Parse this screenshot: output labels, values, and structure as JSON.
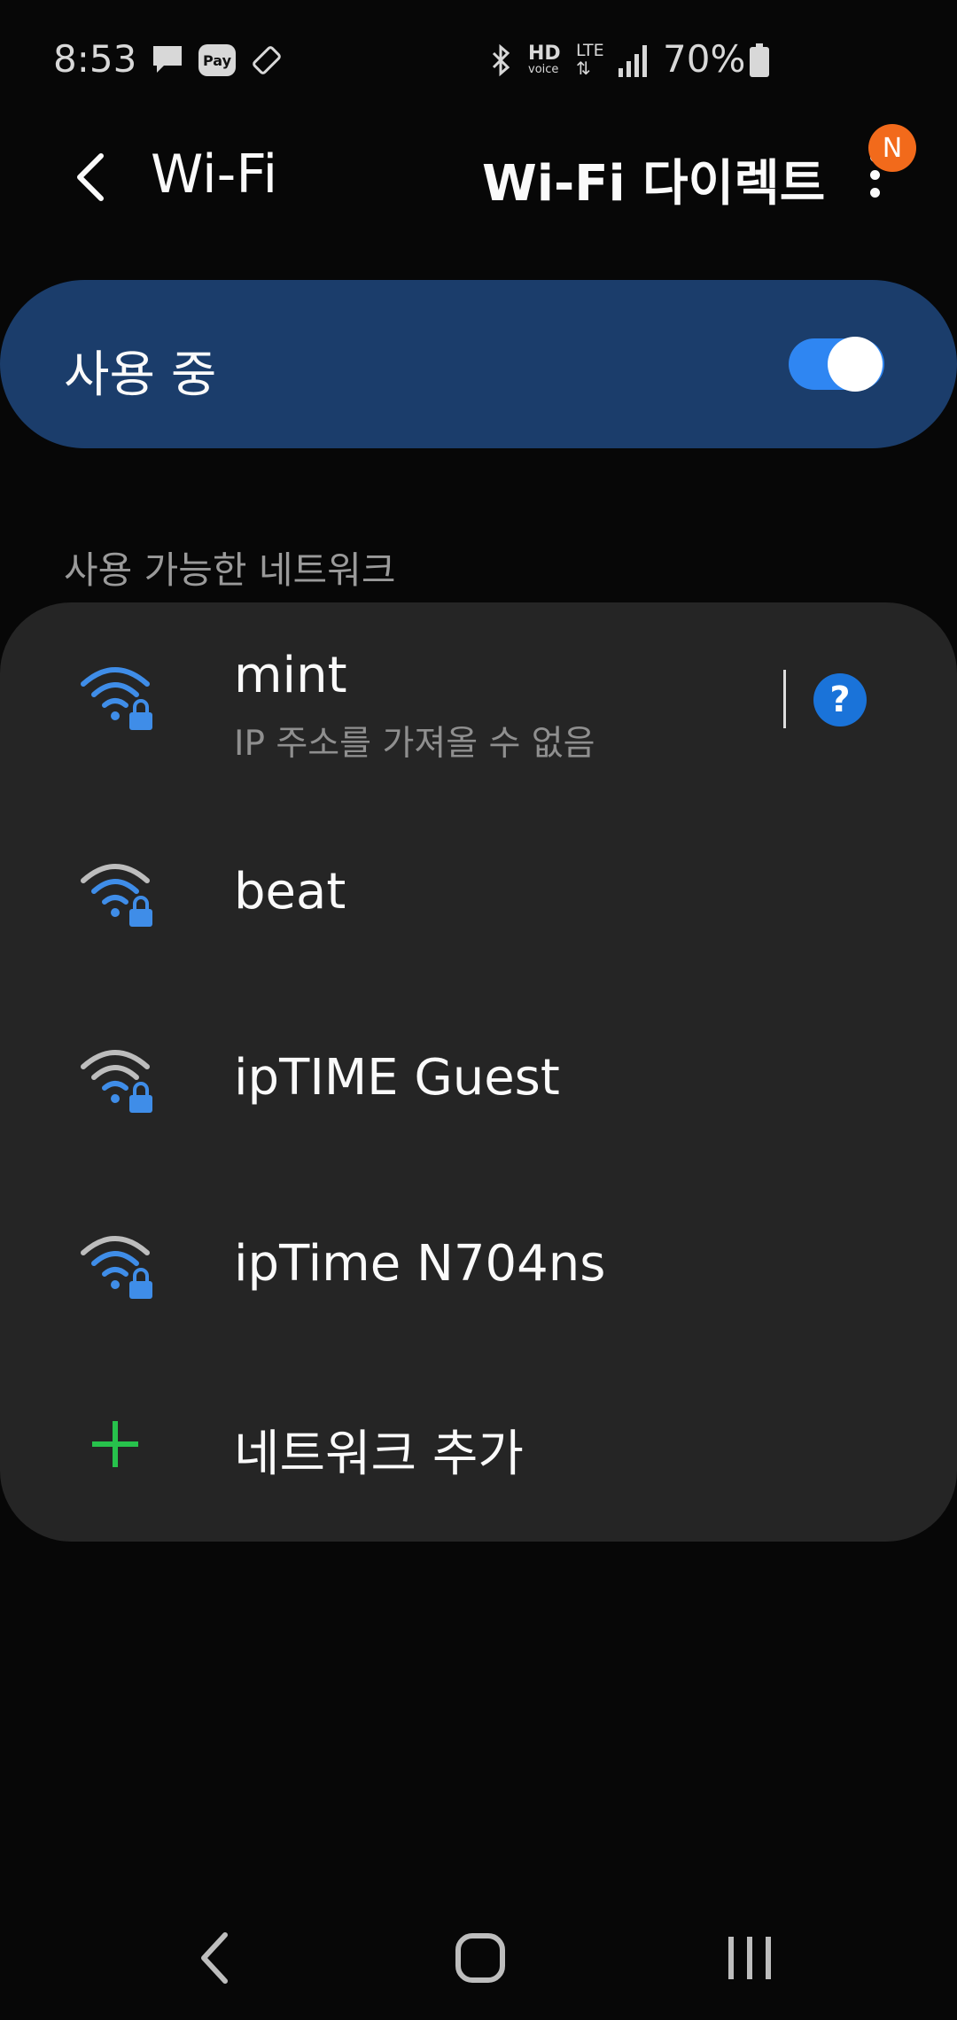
{
  "status_bar": {
    "time": "8:53",
    "battery_percent": "70%",
    "pay_label": "Pay",
    "hd_label": "HD",
    "voice_label": "voice",
    "lte_label": "LTE"
  },
  "header": {
    "title": "Wi-Fi",
    "direct_label": "Wi-Fi 다이렉트",
    "badge": "N"
  },
  "toggle": {
    "label": "사용 중",
    "on": true,
    "accent": "#2f86f2"
  },
  "section_label": "사용 가능한 네트워크",
  "networks": [
    {
      "name": "mint",
      "status": "IP 주소를 가져올 수 없음",
      "icon": "wifi-lock-icon",
      "color": "#3f8de8"
    },
    {
      "name": "beat",
      "icon": "wifi-lock-icon",
      "color": "#3f8de8"
    },
    {
      "name": "ipTIME Guest",
      "icon": "wifi-lock-icon",
      "color": "#3f8de8"
    },
    {
      "name": "ipTime N704ns",
      "icon": "wifi-lock-icon",
      "color": "#3f8de8"
    }
  ],
  "help_label": "?",
  "add_network": "네트워크 추가",
  "colors": {
    "card": "#252525",
    "toggle_card": "#1b3d6b",
    "add_plus": "#27c24c",
    "badge": "#f26a1b"
  }
}
